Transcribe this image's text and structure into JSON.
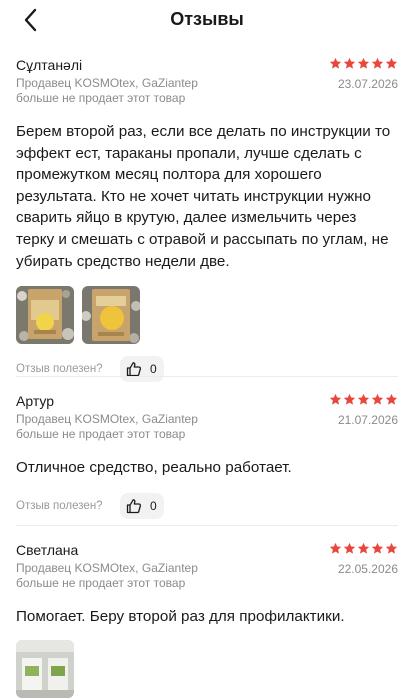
{
  "header": {
    "title": "Отзывы"
  },
  "helpful_label": "Отзыв полезен?",
  "colors": {
    "star": "#e8473d",
    "muted": "#8b8b8b"
  },
  "reviews": [
    {
      "author": "Сұлтанәлі",
      "rating": 5,
      "seller": "Продавец KOSMOtex, GaZiantep",
      "date": "23.07.2026",
      "notice": "больше не продает этот товар",
      "text": "Берем второй раз, если все делать по инструкции то эффект ест, тараканы пропали, лучше сделать с промежутком месяц полтора для хорошего результата. Кто не хочет читать инструкции нужно сварить яйцо в крутую, далее измельчить через терку и смешать с отравой и рассыпать по углам, не убирать средство недели две.",
      "likes": "0"
    },
    {
      "author": "Артур",
      "rating": 5,
      "seller": "Продавец KOSMOtex, GaZiantep",
      "date": "21.07.2026",
      "notice": "больше не продает этот товар",
      "text": "Отличное средство, реально работает.",
      "likes": "0"
    },
    {
      "author": "Светлана",
      "rating": 5,
      "seller": "Продавец KOSMOtex, GaZiantep",
      "date": "22.05.2026",
      "notice": "больше не продает этот товар",
      "text": "Помогает. Беру второй раз для профилактики."
    }
  ]
}
